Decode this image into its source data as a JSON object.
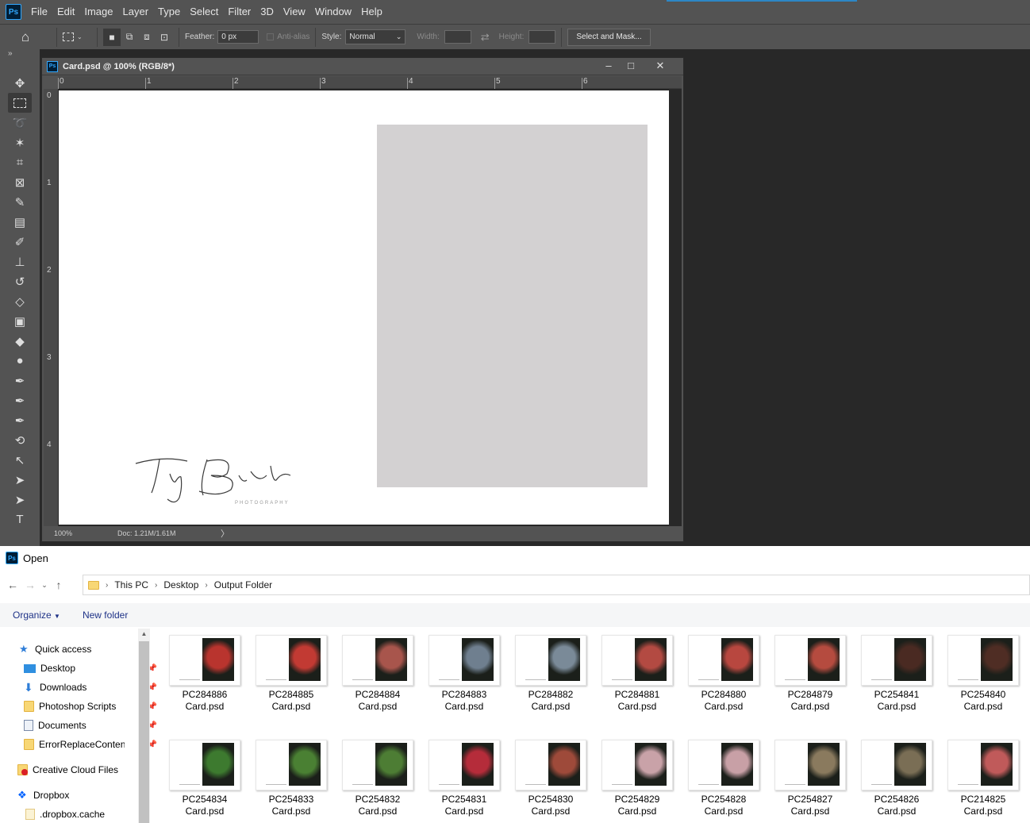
{
  "photoshop": {
    "menu": [
      "File",
      "Edit",
      "Image",
      "Layer",
      "Type",
      "Select",
      "Filter",
      "3D",
      "View",
      "Window",
      "Help"
    ],
    "logo": "Ps",
    "options": {
      "feather_label": "Feather:",
      "feather_value": "0 px",
      "antialias_label": "Anti-alias",
      "style_label": "Style:",
      "style_value": "Normal",
      "width_label": "Width:",
      "height_label": "Height:",
      "select_mask_label": "Select and Mask..."
    },
    "document": {
      "title": "Card.psd @ 100% (RGB/8*)",
      "zoom": "100%",
      "doc_size": "Doc: 1.21M/1.61M",
      "ruler_h": [
        "0",
        "1",
        "2",
        "3",
        "4",
        "5",
        "6"
      ],
      "ruler_v": [
        "0",
        "1",
        "2",
        "3",
        "4"
      ],
      "signature_main": "Tiny Birch",
      "signature_sub": "PHOTOGRAPHY"
    }
  },
  "dialog": {
    "title": "Open",
    "breadcrumb": [
      "This PC",
      "Desktop",
      "Output Folder"
    ],
    "organize_label": "Organize",
    "new_folder_label": "New folder",
    "nav": [
      {
        "label": "Quick access",
        "icon": "star-icon"
      },
      {
        "label": "Desktop",
        "icon": "desktop-icon",
        "pinned": true
      },
      {
        "label": "Downloads",
        "icon": "download-icon",
        "pinned": true
      },
      {
        "label": "Photoshop Scripts",
        "icon": "folder-icon",
        "pinned": true
      },
      {
        "label": "Documents",
        "icon": "documents-icon",
        "pinned": true
      },
      {
        "label": "ErrorReplaceConten",
        "icon": "folder-icon",
        "pinned": true
      },
      {
        "label": "Creative Cloud Files",
        "icon": "creative-cloud-icon"
      },
      {
        "label": "Dropbox",
        "icon": "dropbox-icon"
      },
      {
        "label": ".dropbox.cache",
        "icon": "folder-icon"
      }
    ],
    "files": [
      {
        "name": "PC284886",
        "ext": "Card.psd",
        "color": "#b9342e"
      },
      {
        "name": "PC284885",
        "ext": "Card.psd",
        "color": "#c23a33"
      },
      {
        "name": "PC284884",
        "ext": "Card.psd",
        "color": "#a8554c"
      },
      {
        "name": "PC284883",
        "ext": "Card.psd",
        "color": "#6f7f8f"
      },
      {
        "name": "PC284882",
        "ext": "Card.psd",
        "color": "#7a8a98"
      },
      {
        "name": "PC284881",
        "ext": "Card.psd",
        "color": "#b34a42"
      },
      {
        "name": "PC284880",
        "ext": "Card.psd",
        "color": "#b8473f"
      },
      {
        "name": "PC284879",
        "ext": "Card.psd",
        "color": "#b54b3f"
      },
      {
        "name": "PC254841",
        "ext": "Card.psd",
        "color": "#4a2a22"
      },
      {
        "name": "PC254840",
        "ext": "Card.psd",
        "color": "#4f2d24"
      },
      {
        "name": "PC254834",
        "ext": "Card.psd",
        "color": "#3d7a2f"
      },
      {
        "name": "PC254833",
        "ext": "Card.psd",
        "color": "#4a8033"
      },
      {
        "name": "PC254832",
        "ext": "Card.psd",
        "color": "#4d7d34"
      },
      {
        "name": "PC254831",
        "ext": "Card.psd",
        "color": "#b52c3a"
      },
      {
        "name": "PC254830",
        "ext": "Card.psd",
        "color": "#9e4a3a"
      },
      {
        "name": "PC254829",
        "ext": "Card.psd",
        "color": "#c9a2a8"
      },
      {
        "name": "PC254828",
        "ext": "Card.psd",
        "color": "#c8a0a6"
      },
      {
        "name": "PC254827",
        "ext": "Card.psd",
        "color": "#8a7a5e"
      },
      {
        "name": "PC254826",
        "ext": "Card.psd",
        "color": "#7a6e55"
      },
      {
        "name": "PC214825",
        "ext": "Card.psd",
        "color": "#c05a5a"
      }
    ]
  }
}
